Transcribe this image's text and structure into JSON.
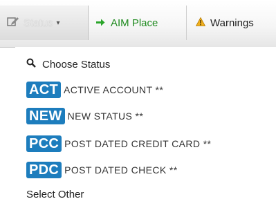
{
  "toolbar": {
    "status_label": "Status",
    "status_icon": "edit-icon",
    "caret": "▾",
    "aim_label": "AIM Place",
    "aim_icon": "arrow-right-icon",
    "warnings_label": "Warnings",
    "warnings_icon": "warning-icon"
  },
  "menu": {
    "choose_label": "Choose Status",
    "choose_icon": "search-icon",
    "options": [
      {
        "code": "ACT",
        "label": "ACTIVE ACCOUNT **"
      },
      {
        "code": "NEW",
        "label": "NEW STATUS **"
      },
      {
        "code": "PCC",
        "label": "POST DATED CREDIT CARD **"
      },
      {
        "code": "PDC",
        "label": "POST DATED CHECK **"
      }
    ],
    "other_label": "Select Other"
  },
  "colors": {
    "badge": "#1d7dbd",
    "aim_text": "#1e8a1e",
    "warning": "#e8a21a"
  }
}
